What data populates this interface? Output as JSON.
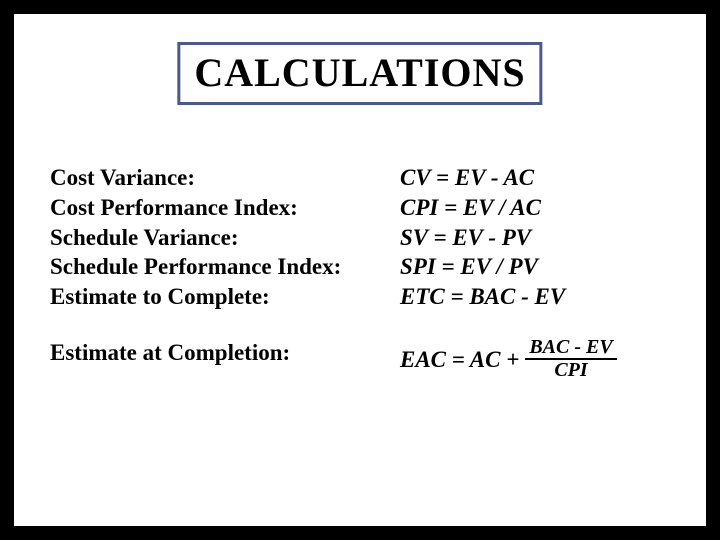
{
  "title": "CALCULATIONS",
  "rows": {
    "r0": {
      "label": "Cost Variance:",
      "formula": "CV = EV - AC"
    },
    "r1": {
      "label": "Cost Performance Index:",
      "formula": "CPI = EV / AC"
    },
    "r2": {
      "label": "Schedule Variance:",
      "formula": "SV = EV - PV"
    },
    "r3": {
      "label": "Schedule Performance Index:",
      "formula": "SPI = EV / PV"
    },
    "r4": {
      "label": "Estimate to Complete:",
      "formula": "ETC = BAC - EV"
    },
    "r5": {
      "label": "Estimate at Completion:",
      "lead": "EAC = AC + ",
      "num": "BAC - EV",
      "den": "CPI"
    }
  }
}
